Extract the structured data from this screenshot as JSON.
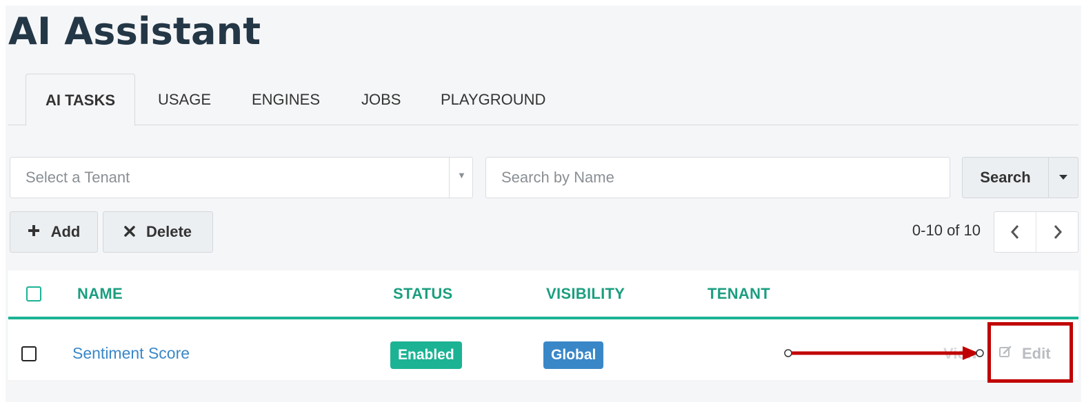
{
  "page": {
    "title": "AI Assistant"
  },
  "tabs": [
    {
      "label": "AI TASKS",
      "active": true
    },
    {
      "label": "USAGE",
      "active": false
    },
    {
      "label": "ENGINES",
      "active": false
    },
    {
      "label": "JOBS",
      "active": false
    },
    {
      "label": "PLAYGROUND",
      "active": false
    }
  ],
  "filters": {
    "tenant_placeholder": "Select a Tenant",
    "search_placeholder": "Search by Name",
    "search_label": "Search"
  },
  "toolbar": {
    "add_label": "Add",
    "delete_label": "Delete",
    "add_icon": "plus-icon",
    "delete_icon": "times-icon"
  },
  "pagination": {
    "range_text": "0-10 of 10"
  },
  "table": {
    "columns": [
      "NAME",
      "STATUS",
      "VISIBILITY",
      "TENANT"
    ],
    "rows": [
      {
        "name": "Sentiment Score",
        "status": "Enabled",
        "visibility": "Global",
        "tenant": "",
        "actions": {
          "view": "View",
          "edit": "Edit"
        }
      }
    ]
  },
  "colors": {
    "accent_green": "#1bb394",
    "link_blue": "#3a87c8",
    "annotation_red": "#c00000",
    "title": "#243746"
  }
}
